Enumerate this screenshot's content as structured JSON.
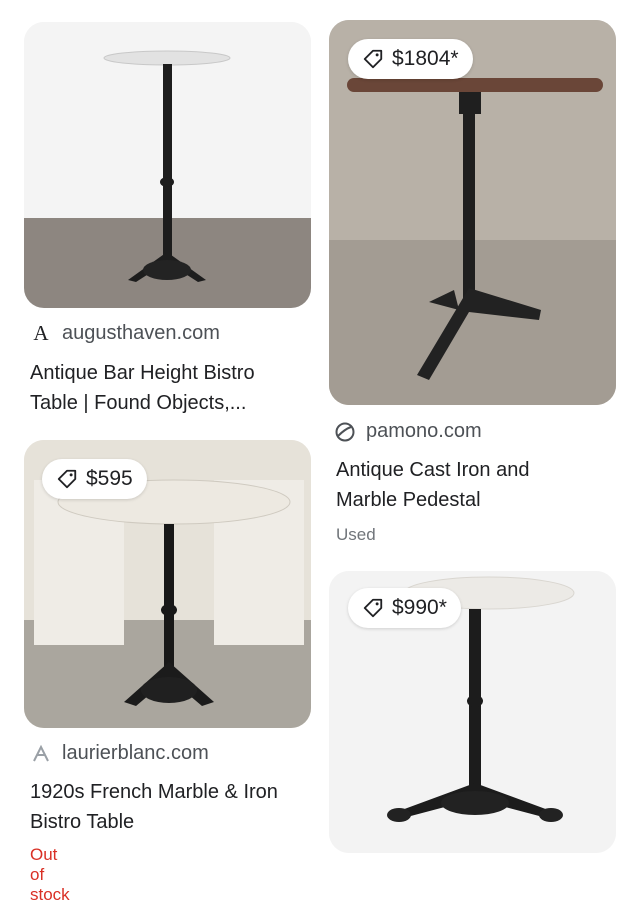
{
  "results": [
    {
      "source": "augusthaven.com",
      "favicon_letter": "A",
      "title_line1": "Antique Bar Height Bistro",
      "title_line2": "Table | Found Objects,..."
    },
    {
      "price": "$1804*",
      "source": "pamono.com",
      "title_line1": "Antique Cast Iron and",
      "title_line2": "Marble Pedestal",
      "condition": "Used"
    },
    {
      "price": "$595",
      "source": "laurierblanc.com",
      "title_line1": "1920s French Marble & Iron",
      "title_line2": "Bistro Table",
      "stock": "Out of stock"
    },
    {
      "price": "$990*"
    }
  ],
  "colors": {
    "stock_red": "#d93025",
    "tag_stroke": "#202124"
  },
  "icons": {
    "price_tag": "tag-icon"
  }
}
